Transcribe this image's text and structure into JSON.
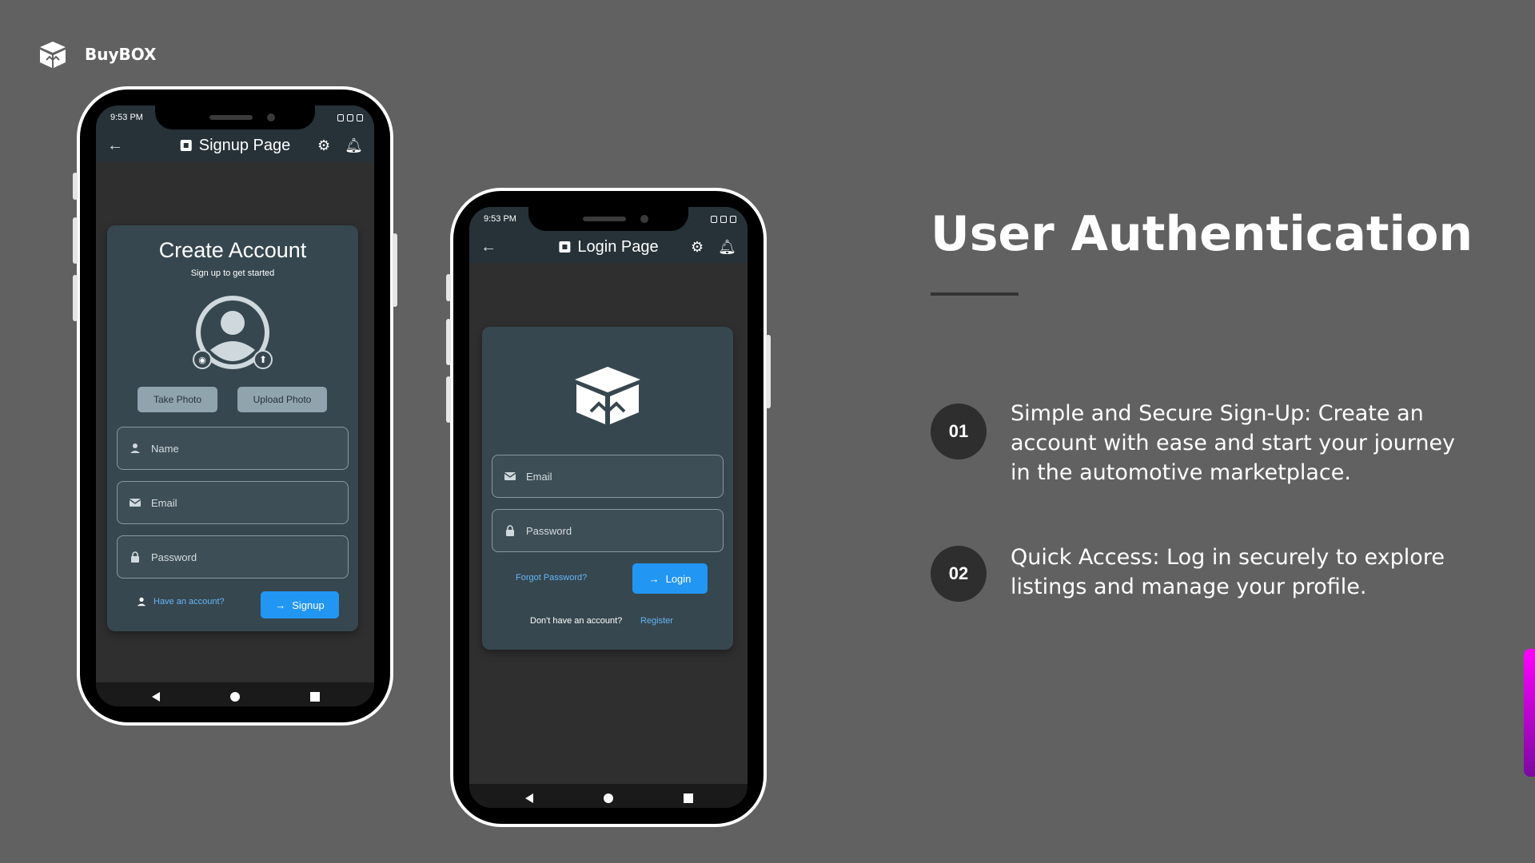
{
  "brand": {
    "name": "BuyBOX",
    "icon": "box-icon"
  },
  "signup_phone": {
    "status_time": "9:53 PM",
    "app_title": "Signup Page",
    "card_title": "Create Account",
    "card_subtitle": "Sign up to get started",
    "take_photo": "Take Photo",
    "upload_photo": "Upload Photo",
    "name_placeholder": "Name",
    "email_placeholder": "Email",
    "password_placeholder": "Password",
    "have_account": "Have an account?",
    "signup_button": "Signup"
  },
  "login_phone": {
    "status_time": "9:53 PM",
    "app_title": "Login Page",
    "email_placeholder": "Email",
    "password_placeholder": "Password",
    "forgot_password": "Forgot Password?",
    "login_button": "Login",
    "no_account": "Don't have an account?",
    "register": "Register"
  },
  "slide": {
    "heading": "User Authentication",
    "points": [
      {
        "number": "01",
        "text": "Simple and Secure Sign-Up: Create an account with ease and start your journey in the automotive marketplace."
      },
      {
        "number": "02",
        "text": "Quick Access: Log in securely to explore listings and manage your profile."
      }
    ]
  },
  "colors": {
    "background": "#616161",
    "appbar": "#263238",
    "card": "#37474f",
    "primary": "#2196f3",
    "link": "#64b5f6",
    "accent": "#ff00ff"
  }
}
